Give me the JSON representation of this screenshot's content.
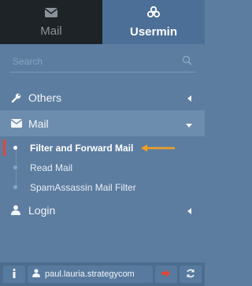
{
  "tabs": [
    {
      "label": "Mail",
      "icon": "envelope-icon"
    },
    {
      "label": "Usermin",
      "icon": "usermin-logo-icon"
    }
  ],
  "search": {
    "placeholder": "Search"
  },
  "menu": {
    "others": {
      "label": "Others"
    },
    "mail": {
      "label": "Mail",
      "subitems": [
        {
          "label": "Filter and Forward Mail"
        },
        {
          "label": "Read Mail"
        },
        {
          "label": "SpamAssassin Mail Filter"
        }
      ]
    },
    "login": {
      "label": "Login"
    }
  },
  "bottom": {
    "user": "paul.lauria.strategycom"
  },
  "colors": {
    "accent_arrow": "#f0a020",
    "active_marker": "#e0453a",
    "sidebar_bg": "#5c7da0"
  }
}
